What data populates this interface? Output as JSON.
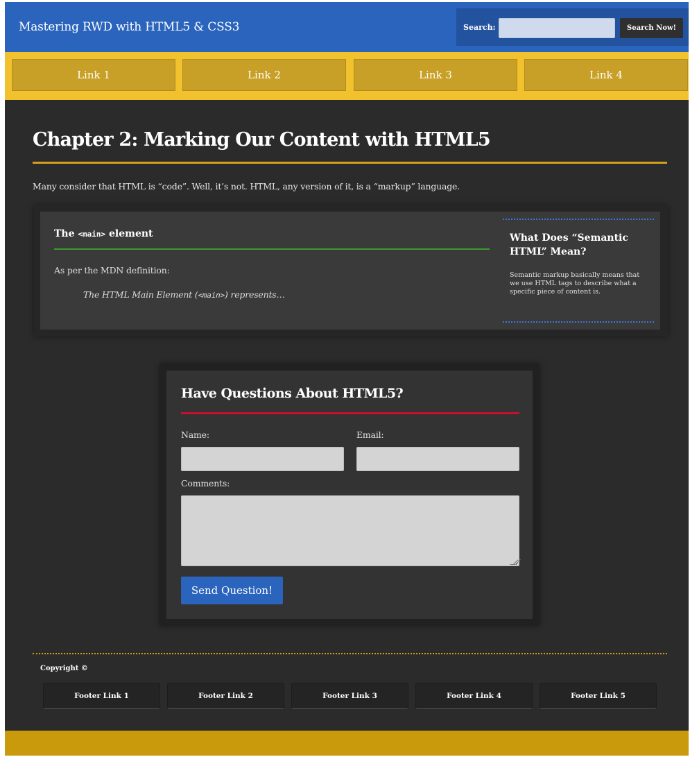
{
  "header": {
    "site_title": "Mastering RWD with HTML5 & CSS3",
    "search_label": "Search:",
    "search_value": "",
    "search_button": "Search Now!"
  },
  "nav": {
    "links": [
      "Link 1",
      "Link 2",
      "Link 3",
      "Link 4"
    ]
  },
  "main": {
    "chapter_title": "Chapter 2: Marking Our Content with HTML5",
    "intro": "Many consider that HTML is “code”. Well, it’s not. HTML, any version of it, is a “markup” language.",
    "article": {
      "heading_prefix": "The ",
      "heading_code": "<main>",
      "heading_suffix": " element",
      "mdn_label": "As per the MDN definition:",
      "quote_prefix": "The HTML Main Element (",
      "quote_code": "<main>",
      "quote_suffix": ") represents…"
    },
    "aside": {
      "title": "What Does “Semantic HTML” Mean?",
      "text": "Semantic markup basically means that we use HTML tags to describe what a specific piece of content is."
    }
  },
  "form": {
    "title": "Have Questions About HTML5?",
    "name_label": "Name:",
    "email_label": "Email:",
    "comments_label": "Comments:",
    "name_value": "",
    "email_value": "",
    "comments_value": "",
    "submit_label": "Send Question!"
  },
  "footer": {
    "copyright": "Copyright ©",
    "links": [
      "Footer Link 1",
      "Footer Link 2",
      "Footer Link 3",
      "Footer Link 4",
      "Footer Link 5"
    ]
  },
  "colors": {
    "header_blue": "#2a64bd",
    "nav_yellow": "#f2c12e",
    "accent_gold": "#d4a01a",
    "accent_green": "#3c9a2f",
    "accent_red": "#c8102e",
    "background_dark": "#2b2b2b"
  }
}
